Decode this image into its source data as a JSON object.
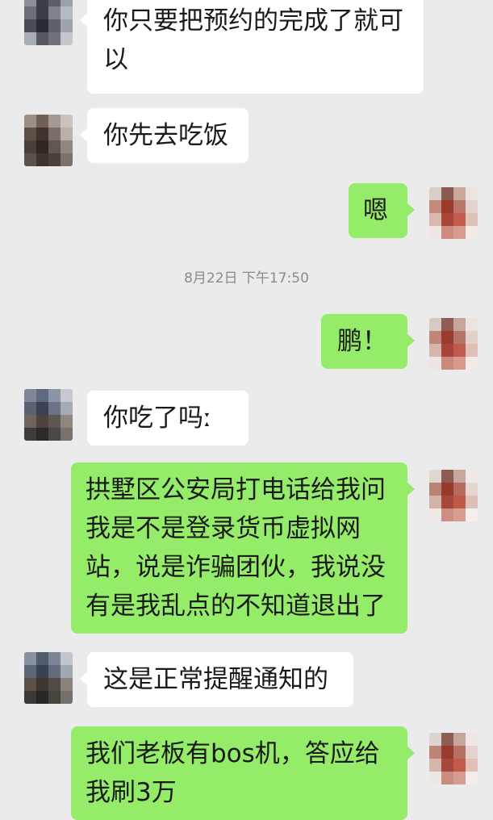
{
  "colors": {
    "background": "#ebebeb",
    "incoming_bubble": "#ffffff",
    "outgoing_bubble": "#95ec69",
    "timestamp_text": "#8a8a8a"
  },
  "timestamp": "8月22日 下午17:50",
  "messages": [
    {
      "direction": "incoming",
      "text": "你只要把预约的完成了就可以"
    },
    {
      "direction": "incoming",
      "text": "你先去吃饭"
    },
    {
      "direction": "outgoing",
      "text": "嗯"
    },
    {
      "direction": "outgoing",
      "text": "鹏！"
    },
    {
      "direction": "incoming",
      "text": "你吃了吗ː"
    },
    {
      "direction": "outgoing",
      "text": "拱墅区公安局打电话给我问我是不是登录货币虚拟网站，说是诈骗团伙，我说没有是我乱点的不知道退出了"
    },
    {
      "direction": "incoming",
      "text": "这是正常提醒通知的"
    },
    {
      "direction": "outgoing",
      "text": "我们老板有bos机，答应给我刷3万"
    }
  ]
}
